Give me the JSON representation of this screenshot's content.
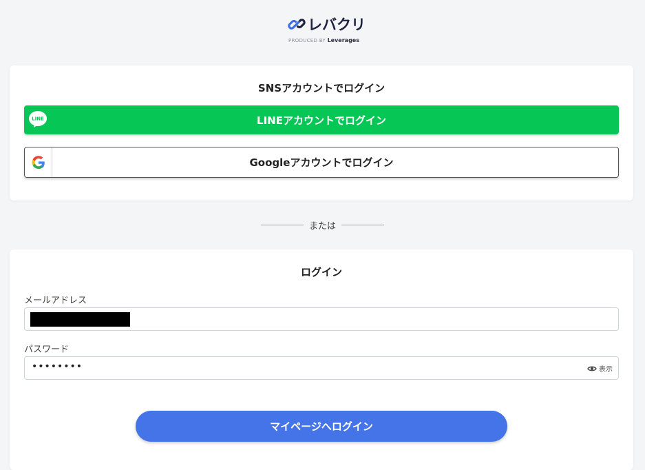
{
  "brand": {
    "name": "レバクリ",
    "produced_by": "PRODUCED BY",
    "company": "Leverages"
  },
  "sns": {
    "title": "SNSアカウントでログイン",
    "line_icon_text": "LINE",
    "line_button": "LINEアカウントでログイン",
    "google_button": "Googleアカウントでログイン"
  },
  "divider": "または",
  "login": {
    "title": "ログイン",
    "email_label": "メールアドレス",
    "password_label": "パスワード",
    "password_value": "••••••••",
    "show_label": "表示",
    "submit": "マイページへログイン"
  },
  "colors": {
    "line_green": "#06c755",
    "primary_blue": "#4474e8"
  }
}
